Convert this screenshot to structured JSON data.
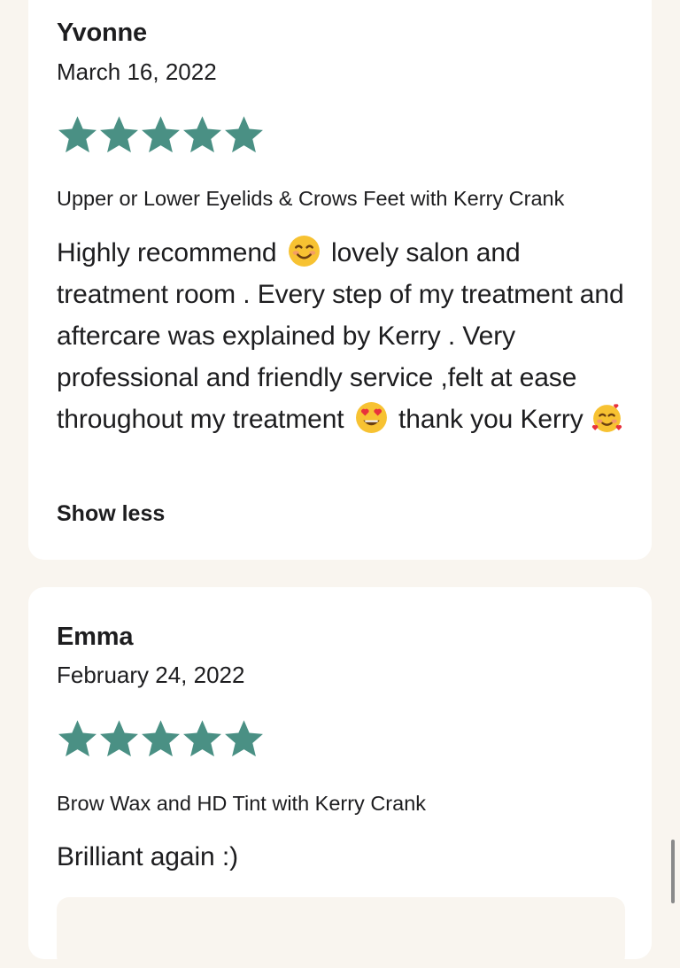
{
  "reviews": [
    {
      "name": "Yvonne",
      "date": "March 16, 2022",
      "rating": 5,
      "service": "Upper or Lower Eyelids & Crows Feet with Kerry Crank",
      "text_parts": [
        "Highly recommend",
        "lovely salon and treatment room . Every step of my treatment and aftercare was explained by Kerry . Very professional and friendly service ,felt at ease throughout my treatment",
        "thank you Kerry"
      ],
      "emojis": [
        "smiling-face-emoji",
        "heart-eyes-emoji",
        "smiling-face-with-hearts-emoji"
      ],
      "toggle_label": "Show less"
    },
    {
      "name": "Emma",
      "date": "February 24, 2022",
      "rating": 5,
      "service": "Brow Wax and HD Tint with Kerry Crank",
      "text": "Brilliant again :)"
    }
  ],
  "colors": {
    "page_bg": "#f9f5ef",
    "card_bg": "#ffffff",
    "star": "#4a9084",
    "text": "#1d1d1f"
  }
}
